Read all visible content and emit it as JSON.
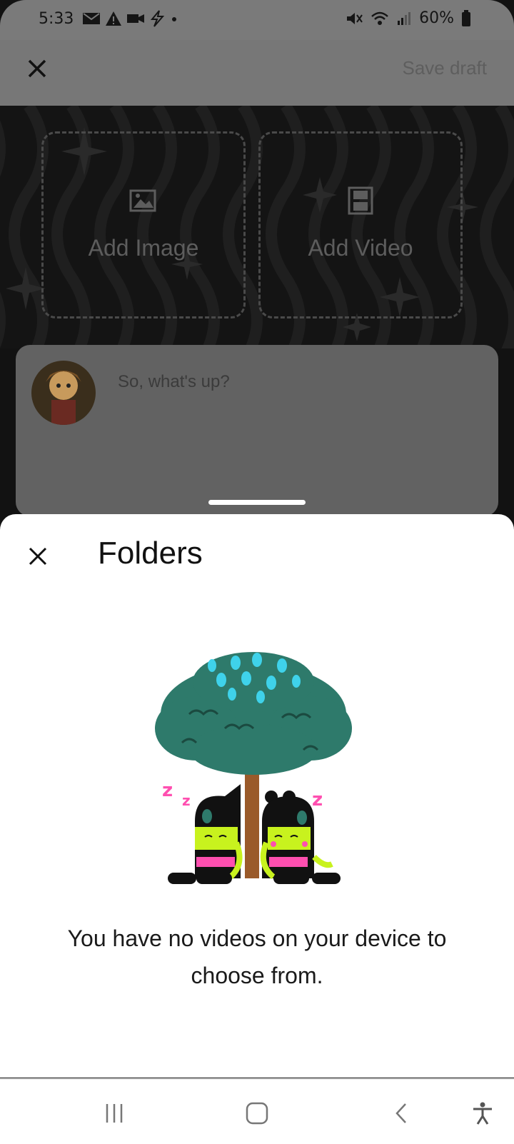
{
  "status_bar": {
    "time": "5:33",
    "battery": "60%",
    "icons": [
      "mail-icon",
      "alert-icon",
      "video-camera-icon",
      "bolt-icon",
      "dot-icon",
      "vibrate-icon",
      "wifi-icon",
      "signal-icon",
      "battery-icon"
    ]
  },
  "top_bar": {
    "close_icon": "close-icon",
    "save_draft": "Save draft"
  },
  "media": {
    "add_image": "Add Image",
    "add_video": "Add Video"
  },
  "post": {
    "placeholder": "So, what's up?"
  },
  "sheet": {
    "title": "Folders",
    "empty_message": "You have no videos on your device to choose from.",
    "illustration": "sleeping-characters-under-tree"
  },
  "nav_bar": {
    "buttons": [
      "recent-apps-icon",
      "home-icon",
      "back-icon",
      "accessibility-icon"
    ]
  },
  "colors": {
    "overlay_dim": "#777777",
    "sheet_bg": "#ffffff",
    "tree_green": "#2e7a6b",
    "tree_spots": "#3fd2ea",
    "character_lime": "#c8f21e",
    "character_pink": "#ff4fb0"
  }
}
